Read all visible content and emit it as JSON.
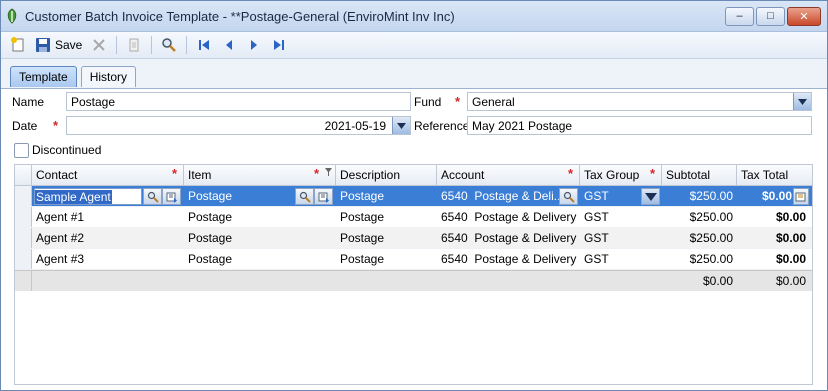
{
  "window": {
    "title": "Customer Batch Invoice Template - **Postage-General (EnviroMint Inv Inc)",
    "minimize": "–",
    "maximize": "□",
    "close": "✕"
  },
  "toolbar": {
    "save_label": "Save"
  },
  "tabs": [
    {
      "label": "Template",
      "active": true
    },
    {
      "label": "History",
      "active": false
    }
  ],
  "form": {
    "name_label": "Name",
    "name_value": "Postage",
    "fund_label": "Fund",
    "fund_value": "General",
    "date_label": "Date",
    "date_value": "2021-05-19",
    "reference_label": "Reference",
    "reference_value": "May 2021 Postage",
    "discontinued_label": "Discontinued",
    "required_mark": "*"
  },
  "grid": {
    "headers": {
      "contact": "Contact",
      "item": "Item",
      "description": "Description",
      "account": "Account",
      "tax_group": "Tax Group",
      "subtotal": "Subtotal",
      "tax_total": "Tax Total"
    },
    "rows": [
      {
        "contact": "Sample Agent",
        "item": "Postage",
        "description": "Postage",
        "account_no": "6540",
        "account_name": "Postage & Deli...",
        "tax_group": "GST",
        "subtotal": "$250.00",
        "tax_total": "$0.00"
      },
      {
        "contact": "Agent #1",
        "item": "Postage",
        "description": "Postage",
        "account_no": "6540",
        "account_name": "Postage & Delivery",
        "tax_group": "GST",
        "subtotal": "$250.00",
        "tax_total": "$0.00"
      },
      {
        "contact": "Agent #2",
        "item": "Postage",
        "description": "Postage",
        "account_no": "6540",
        "account_name": "Postage & Delivery",
        "tax_group": "GST",
        "subtotal": "$250.00",
        "tax_total": "$0.00"
      },
      {
        "contact": "Agent #3",
        "item": "Postage",
        "description": "Postage",
        "account_no": "6540",
        "account_name": "Postage & Delivery",
        "tax_group": "GST",
        "subtotal": "$250.00",
        "tax_total": "$0.00"
      }
    ],
    "totals": {
      "subtotal": "$0.00",
      "tax_total": "$0.00"
    }
  },
  "colors": {
    "selection": "#3b7ed6",
    "required": "#d4262a",
    "titlebar": "#c4d6ef"
  },
  "icons": [
    "app-icon",
    "new-icon",
    "save-icon",
    "delete-icon",
    "print-icon",
    "find-icon",
    "first-record-icon",
    "previous-record-icon",
    "next-record-icon",
    "last-record-icon",
    "lookup-icon",
    "details-icon",
    "filter-icon",
    "chevron-down-icon"
  ]
}
